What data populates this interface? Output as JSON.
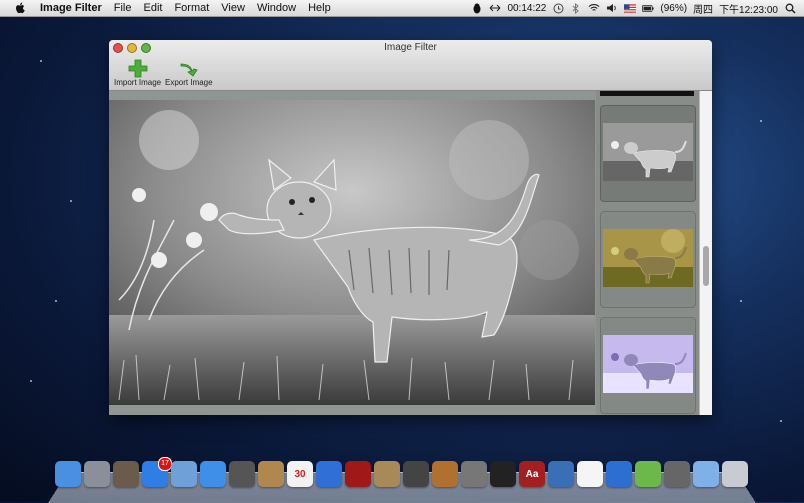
{
  "menubar": {
    "app_name": "Image Filter",
    "items": [
      "File",
      "Edit",
      "Format",
      "View",
      "Window",
      "Help"
    ],
    "status": {
      "timer": "00:14:22",
      "battery": "(96%)",
      "day": "周四",
      "time": "下午12:23:00"
    }
  },
  "window": {
    "title": "Image Filter",
    "toolbar": {
      "import_label": "Import Image",
      "export_label": "Export Image"
    },
    "thumbnails": [
      "grayscale",
      "sepia",
      "inverted"
    ]
  },
  "dock": {
    "items": [
      {
        "icon": "finder-icon",
        "color": "#4a8fe0"
      },
      {
        "icon": "launchpad-icon",
        "color": "#8a8f99"
      },
      {
        "icon": "mission-control-icon",
        "color": "#6b5b4a"
      },
      {
        "icon": "app-store-icon",
        "color": "#2f7ee6",
        "badge": "17"
      },
      {
        "icon": "preview-icon",
        "color": "#6fa0d8"
      },
      {
        "icon": "safari-icon",
        "color": "#3f8ee8"
      },
      {
        "icon": "facetime-icon",
        "color": "#555"
      },
      {
        "icon": "contacts-icon",
        "color": "#b0874e"
      },
      {
        "icon": "calendar-icon",
        "color": "#f2f2f2",
        "label": "30"
      },
      {
        "icon": "itunes-icon",
        "color": "#2f6fd6"
      },
      {
        "icon": "photo-booth-icon",
        "color": "#a01818"
      },
      {
        "icon": "iphoto-icon",
        "color": "#a88a58"
      },
      {
        "icon": "imovie-icon",
        "color": "#444"
      },
      {
        "icon": "garageband-icon",
        "color": "#b07030"
      },
      {
        "icon": "system-preferences-icon",
        "color": "#777"
      },
      {
        "icon": "activity-monitor-icon",
        "color": "#222"
      },
      {
        "icon": "dictionary-icon",
        "color": "#a42020",
        "label": "Aa"
      },
      {
        "icon": "stocks-icon",
        "color": "#3a6fb8"
      },
      {
        "icon": "qq-icon",
        "color": "#f5f5f5"
      },
      {
        "icon": "xcode-icon",
        "color": "#2d6fd0"
      },
      {
        "icon": "leaf-icon",
        "color": "#6db84a"
      },
      {
        "icon": "window-icon",
        "color": "#666"
      },
      {
        "icon": "folder-icon",
        "color": "#7fb1e8"
      },
      {
        "icon": "trash-icon",
        "color": "#c8ccd2"
      }
    ]
  }
}
